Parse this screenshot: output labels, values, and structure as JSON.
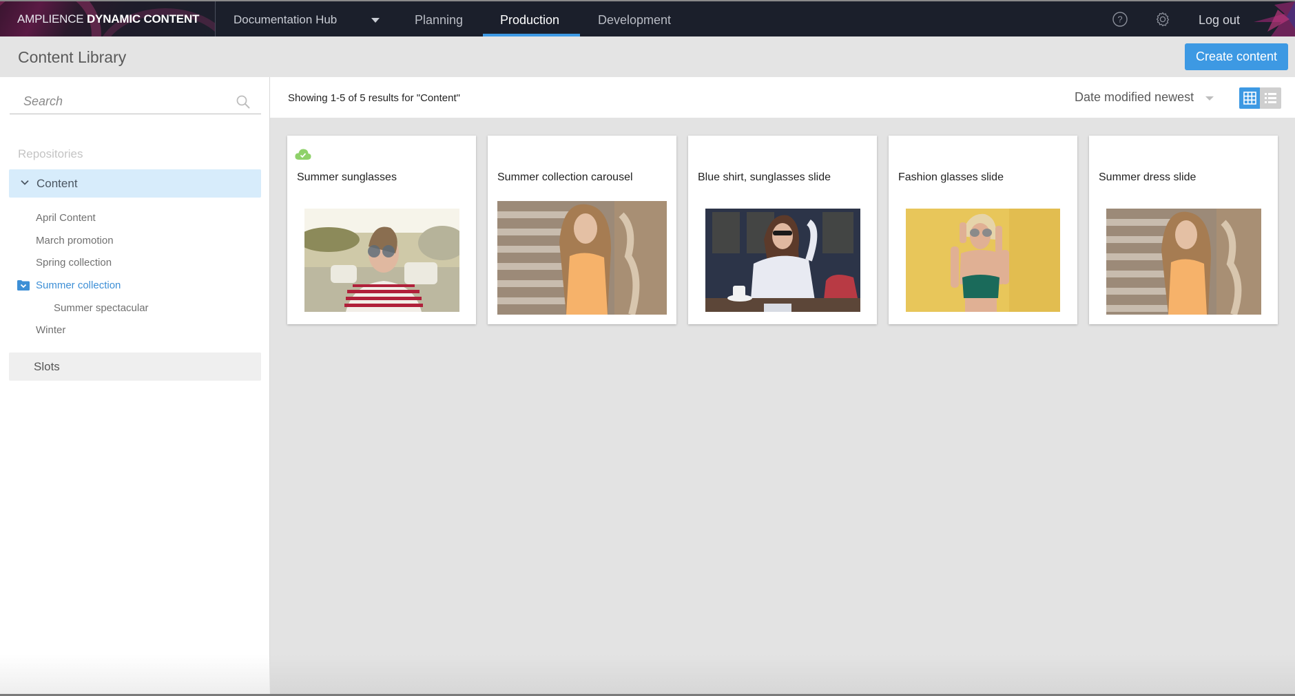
{
  "header": {
    "brand_light": "AMPLIENCE",
    "brand_bold": "DYNAMIC CONTENT",
    "hub_name": "Documentation Hub",
    "tabs": [
      {
        "label": "Planning",
        "active": false
      },
      {
        "label": "Production",
        "active": true
      },
      {
        "label": "Development",
        "active": false
      }
    ],
    "help_icon": "help-circle-icon",
    "settings_icon": "gear-icon",
    "logout_label": "Log out"
  },
  "subheader": {
    "title": "Content Library",
    "create_button": "Create content"
  },
  "sidebar": {
    "search": {
      "placeholder": "Search",
      "value": ""
    },
    "repositories_label": "Repositories",
    "repository": {
      "label": "Content",
      "expanded": true
    },
    "folders": [
      {
        "label": "April Content",
        "level": 1,
        "selected": false
      },
      {
        "label": "March promotion",
        "level": 1,
        "selected": false
      },
      {
        "label": "Spring collection",
        "level": 1,
        "selected": false
      },
      {
        "label": "Summer collection",
        "level": 1,
        "selected": true,
        "expanded": true
      },
      {
        "label": "Summer spectacular",
        "level": 2,
        "selected": false
      },
      {
        "label": "Winter",
        "level": 1,
        "selected": false
      }
    ],
    "slots_label": "Slots"
  },
  "results": {
    "summary": "Showing 1-5 of 5 results for \"Content\"",
    "sort_label": "Date modified newest",
    "view_modes": [
      {
        "name": "grid",
        "active": true
      },
      {
        "name": "list",
        "active": false
      }
    ]
  },
  "cards": [
    {
      "title": "Summer sunglasses",
      "status": "published",
      "thumbnail": "woman in striped shirt with round sunglasses on street"
    },
    {
      "title": "Summer collection carousel",
      "status": "",
      "thumbnail": "woman in orange top leaning on stone wall"
    },
    {
      "title": "Blue shirt, sunglasses slide",
      "status": "",
      "thumbnail": "woman in blue shirt with sunglasses at cafe"
    },
    {
      "title": "Fashion glasses slide",
      "status": "",
      "thumbnail": "woman with sunglasses against yellow wall"
    },
    {
      "title": "Summer dress slide",
      "status": "",
      "thumbnail": "woman in orange top leaning on stone wall"
    }
  ],
  "colors": {
    "accent": "#3d99e3",
    "header_bg": "#1b1f2b",
    "selected_repo_bg": "#d7ecfb",
    "status_published": "#8fd16a"
  }
}
